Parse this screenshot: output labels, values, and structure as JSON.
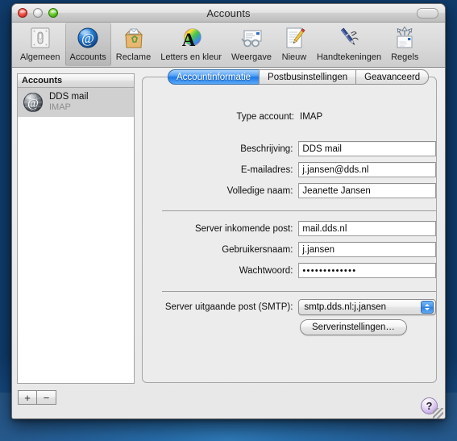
{
  "window": {
    "title": "Accounts",
    "controls": {
      "close": "close-button",
      "minimize": "minimize-button",
      "zoom": "zoom-button",
      "toolbar_toggle": "toolbar-toggle-pill"
    }
  },
  "toolbar": {
    "items": [
      {
        "label": "Algemeen",
        "icon": "general-switch-icon",
        "selected": false
      },
      {
        "label": "Accounts",
        "icon": "at-sign-icon",
        "selected": true
      },
      {
        "label": "Reclame",
        "icon": "junk-mail-bag-icon",
        "selected": false
      },
      {
        "label": "Letters en kleur",
        "icon": "fonts-colors-icon",
        "selected": false
      },
      {
        "label": "Weergave",
        "icon": "viewing-glasses-icon",
        "selected": false
      },
      {
        "label": "Nieuw",
        "icon": "compose-pencil-icon",
        "selected": false
      },
      {
        "label": "Handtekeningen",
        "icon": "signature-pen-icon",
        "selected": false
      },
      {
        "label": "Regels",
        "icon": "rules-arrows-icon",
        "selected": false
      }
    ]
  },
  "sidebar": {
    "header": "Accounts",
    "accounts": [
      {
        "name": "DDS mail",
        "kind": "IMAP",
        "icon": "account-globe-at-icon",
        "selected": true
      }
    ],
    "add_label": "+",
    "remove_label": "−"
  },
  "tabs": [
    {
      "label": "Accountinformatie",
      "active": true
    },
    {
      "label": "Postbusinstellingen",
      "active": false
    },
    {
      "label": "Geavanceerd",
      "active": false
    }
  ],
  "form": {
    "account_type": {
      "label": "Type account:",
      "value": "IMAP"
    },
    "fields": [
      {
        "label": "Beschrijving:",
        "value": "DDS mail",
        "type": "text"
      },
      {
        "label": "E‑mailadres:",
        "value": "j.jansen@dds.nl",
        "type": "text"
      },
      {
        "label": "Volledige naam:",
        "value": "Jeanette Jansen",
        "type": "text"
      },
      {
        "label": "Server inkomende post:",
        "value": "mail.dds.nl",
        "type": "text"
      },
      {
        "label": "Gebruikersnaam:",
        "value": "j.jansen",
        "type": "text"
      },
      {
        "label": "Wachtwoord:",
        "value": "•••••••••••••",
        "type": "password"
      }
    ],
    "smtp": {
      "label": "Server uitgaande post (SMTP):",
      "value": "smtp.dds.nl:j.jansen",
      "settings_button": "Serverinstellingen…"
    }
  },
  "help": {
    "label": "?"
  },
  "colors": {
    "accent_blue": "#1e78e8",
    "selection_gray": "#d0d0d0",
    "window_bg": "#ededed",
    "panel_bg": "#ececec"
  }
}
